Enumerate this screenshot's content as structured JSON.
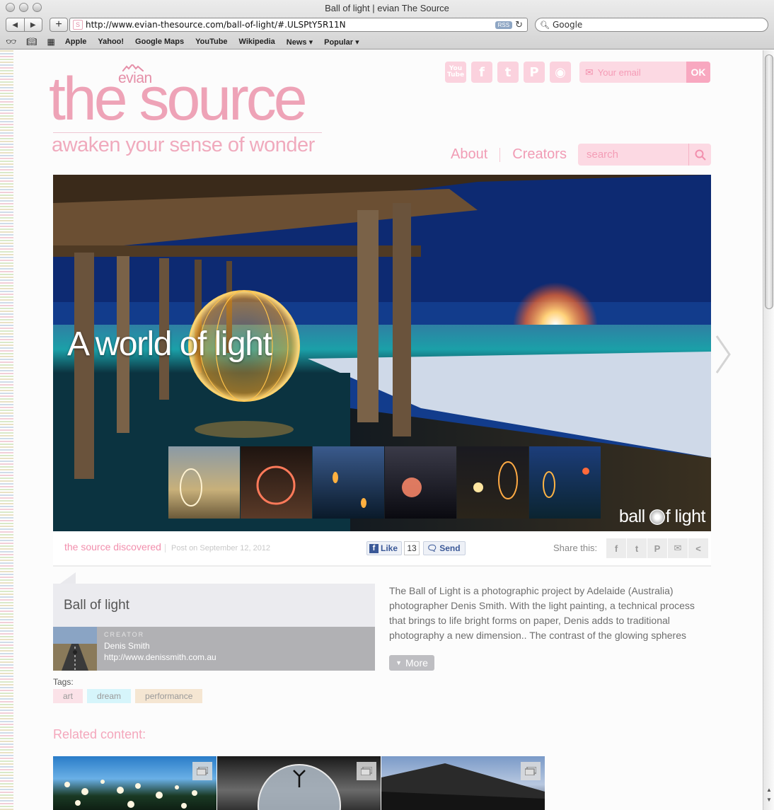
{
  "browser": {
    "window_title": "Ball of light | evian The Source",
    "url": "http://www.evian-thesource.com/ball-of-light/#.ULSPtY5R11N",
    "rss_label": "RSS",
    "search_placeholder": "Google",
    "bookmarks": [
      "Apple",
      "Yahoo!",
      "Google Maps",
      "YouTube",
      "Wikipedia",
      "News ▾",
      "Popular ▾"
    ]
  },
  "header": {
    "brand": "evian",
    "logo_main": "the source",
    "tagline": "awaken your sense of wonder",
    "social": {
      "youtube_text": "You Tube",
      "facebook": "f",
      "twitter": "t",
      "pinterest": "P",
      "rss": "◉"
    },
    "email_placeholder": "Your email",
    "email_submit": "OK",
    "nav": {
      "about": "About",
      "creators": "Creators"
    },
    "search_placeholder": "search"
  },
  "hero": {
    "title": "A world of light",
    "brand_left": "ball",
    "brand_right": "f light"
  },
  "info_strip": {
    "category": "the source discovered",
    "post_date": "Post on September 12, 2012",
    "like_label": "Like",
    "like_count": "13",
    "send_label": "Send",
    "share_label": "Share this:"
  },
  "article": {
    "title": "Ball of light",
    "creator_label": "CREATOR",
    "creator_name": "Denis Smith",
    "creator_url": "http://www.denissmith.com.au",
    "description": "The Ball of Light is a photographic project by Adelaide (Australia) photographer Denis Smith. With the light painting, a technical process that brings to life bright forms on paper, Denis adds to traditional photography a new dimension.. The contrast of the glowing spheres",
    "more_label": "More",
    "tags_label": "Tags:",
    "tags": [
      "art",
      "dream",
      "performance"
    ]
  },
  "related": {
    "title": "Related content:"
  },
  "colors": {
    "brand_pink": "#eea3b7",
    "light_pink": "#fcd9e3",
    "facebook_blue": "#3b5998"
  }
}
